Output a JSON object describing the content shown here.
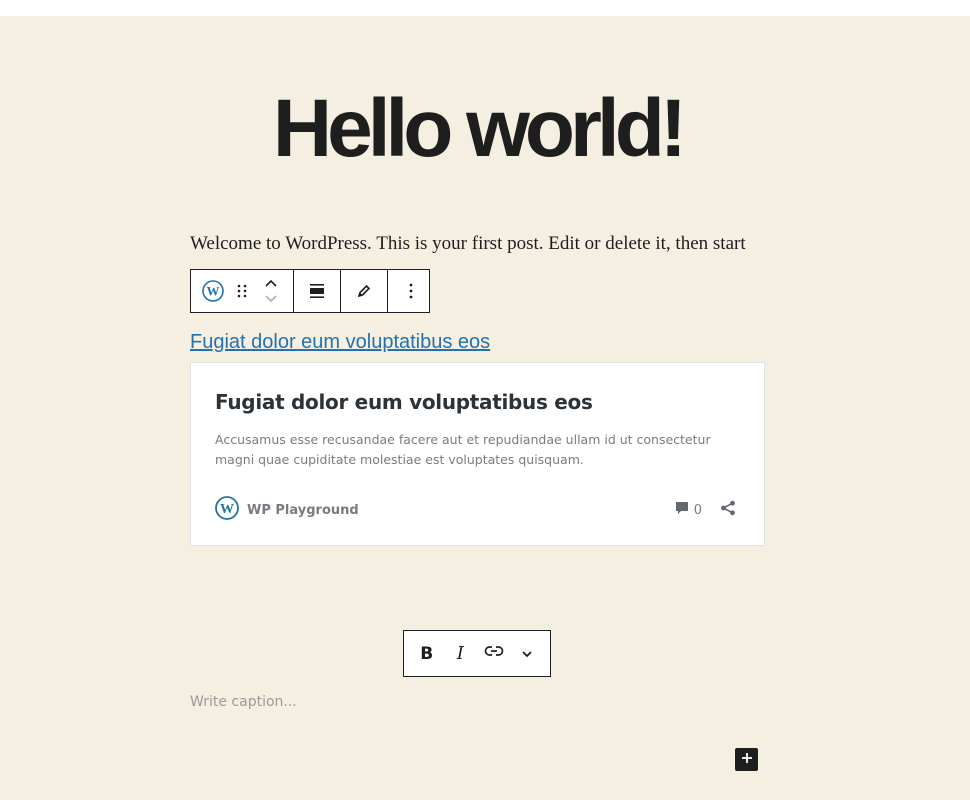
{
  "post": {
    "title": "Hello world!",
    "paragraph": "Welcome to WordPress. This is your first post. Edit or delete it, then start"
  },
  "block_toolbar": {
    "icons": [
      "wordpress-logo",
      "drag-handle",
      "move-up",
      "move-down",
      "align",
      "edit-pencil",
      "more-options"
    ]
  },
  "embed": {
    "link_text": "Fugiat dolor eum voluptatibus eos",
    "card": {
      "title": "Fugiat dolor eum voluptatibus eos",
      "excerpt": "Accusamus esse recusandae facere aut et repudiandae ullam id ut consectetur magni quae cupiditate molestiae est voluptates quisquam.",
      "site_name": "WP Playground",
      "comment_count": "0"
    },
    "colors": {
      "link": "#2271b1",
      "wp_blue": "#21759b"
    }
  },
  "format_toolbar": {
    "bold_label": "B",
    "italic_label": "I",
    "icons": [
      "bold",
      "italic",
      "link",
      "chevron-down"
    ]
  },
  "caption": {
    "placeholder": "Write caption..."
  },
  "colors": {
    "canvas": "#f4efe1",
    "text": "#1e1e1e"
  }
}
